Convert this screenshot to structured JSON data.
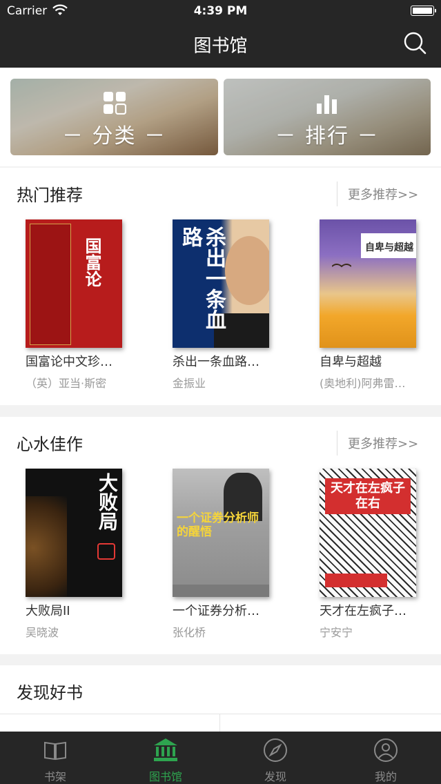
{
  "status_bar": {
    "carrier": "Carrier",
    "time": "4:39 PM"
  },
  "nav": {
    "title": "图书馆",
    "search_icon": "search-icon"
  },
  "banners": [
    {
      "label": "－ 分类 －",
      "icon": "grid-icon"
    },
    {
      "label": "－ 排行 －",
      "icon": "bar-chart-icon"
    }
  ],
  "sections": [
    {
      "title": "热门推荐",
      "more": "更多推荐>>",
      "books": [
        {
          "title": "国富论中文珍…",
          "author": "（英）亚当·斯密",
          "cover_text": "国富论"
        },
        {
          "title": "杀出一条血路…",
          "author": "金振业",
          "cover_text": "杀出一条血路"
        },
        {
          "title": "自卑与超越",
          "author": "(奥地利)阿弗雷…",
          "cover_text": "自卑与超越"
        }
      ]
    },
    {
      "title": "心水佳作",
      "more": "更多推荐>>",
      "books": [
        {
          "title": "大败局II",
          "author": "吴晓波",
          "cover_text": "大败局"
        },
        {
          "title": "一个证券分析…",
          "author": "张化桥",
          "cover_text": "一个证券分析师的醒悟"
        },
        {
          "title": "天才在左疯子…",
          "author": "宁安宁",
          "cover_text": "天才在左疯子在右"
        }
      ]
    }
  ],
  "discover": {
    "title": "发现好书"
  },
  "tabs": [
    {
      "label": "书架",
      "icon": "book-icon",
      "active": false
    },
    {
      "label": "图书馆",
      "icon": "library-icon",
      "active": true
    },
    {
      "label": "发现",
      "icon": "compass-icon",
      "active": false
    },
    {
      "label": "我的",
      "icon": "user-icon",
      "active": false
    }
  ],
  "colors": {
    "bar_bg": "#262626",
    "accent": "#2ea44f"
  }
}
